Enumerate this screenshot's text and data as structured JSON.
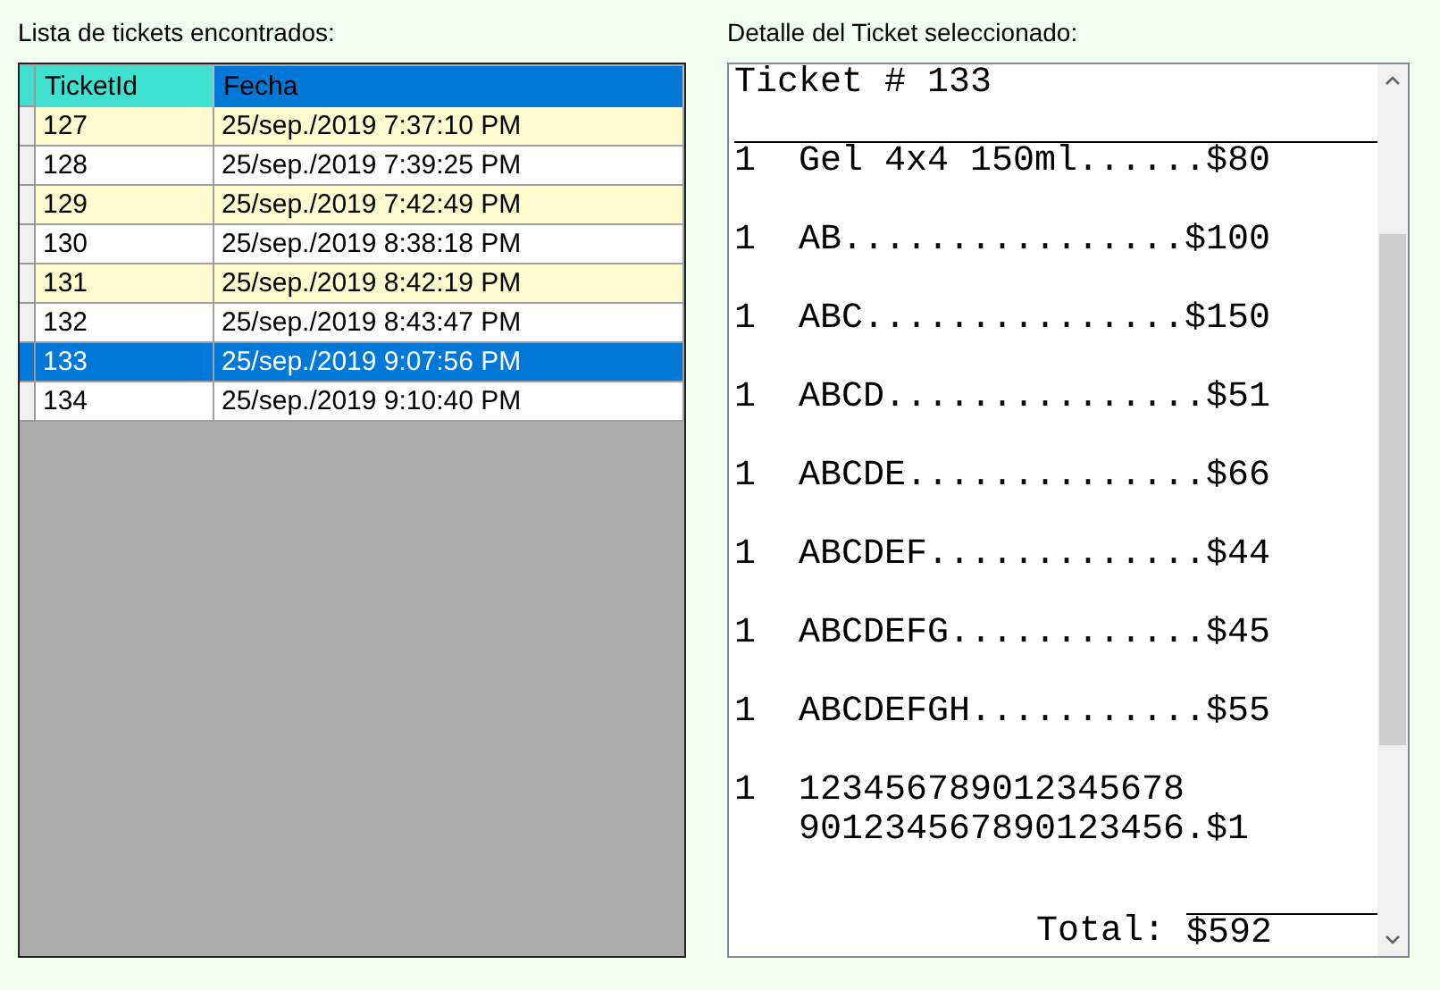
{
  "left_panel": {
    "label": "Lista de tickets encontrados:",
    "table": {
      "columns": [
        {
          "label": "TicketId",
          "color": "#40e0d0"
        },
        {
          "label": "Fecha",
          "color": "#0078d7"
        }
      ],
      "rows": [
        {
          "cells": [
            "127",
            "25/sep./2019 7:37:10 PM"
          ],
          "selected": false
        },
        {
          "cells": [
            "128",
            "25/sep./2019 7:39:25 PM"
          ],
          "selected": false
        },
        {
          "cells": [
            "129",
            "25/sep./2019 7:42:49 PM"
          ],
          "selected": false
        },
        {
          "cells": [
            "130",
            "25/sep./2019 8:38:18 PM"
          ],
          "selected": false
        },
        {
          "cells": [
            "131",
            "25/sep./2019 8:42:19 PM"
          ],
          "selected": false
        },
        {
          "cells": [
            "132",
            "25/sep./2019 8:43:47 PM"
          ],
          "selected": false
        },
        {
          "cells": [
            "133",
            "25/sep./2019 9:07:56 PM"
          ],
          "selected": true
        },
        {
          "cells": [
            "134",
            "25/sep./2019 9:10:40 PM"
          ],
          "selected": false
        }
      ]
    }
  },
  "right_panel": {
    "label": "Detalle del Ticket seleccionado:",
    "ticket": {
      "title": "Ticket # 133",
      "items": [
        {
          "qty": "1",
          "lines": [
            "Gel 4x4 150ml......$80"
          ]
        },
        {
          "qty": "1",
          "lines": [
            "AB................$100"
          ]
        },
        {
          "qty": "1",
          "lines": [
            "ABC...............$150"
          ]
        },
        {
          "qty": "1",
          "lines": [
            "ABCD...............$51"
          ]
        },
        {
          "qty": "1",
          "lines": [
            "ABCDE..............$66"
          ]
        },
        {
          "qty": "1",
          "lines": [
            "ABCDEF.............$44"
          ]
        },
        {
          "qty": "1",
          "lines": [
            "ABCDEFG............$45"
          ]
        },
        {
          "qty": "1",
          "lines": [
            "ABCDEFGH...........$55"
          ]
        },
        {
          "qty": "1",
          "lines": [
            "123456789012345678",
            "901234567890123456.$1"
          ]
        }
      ],
      "total_label": "Total:",
      "total": "$592"
    }
  }
}
